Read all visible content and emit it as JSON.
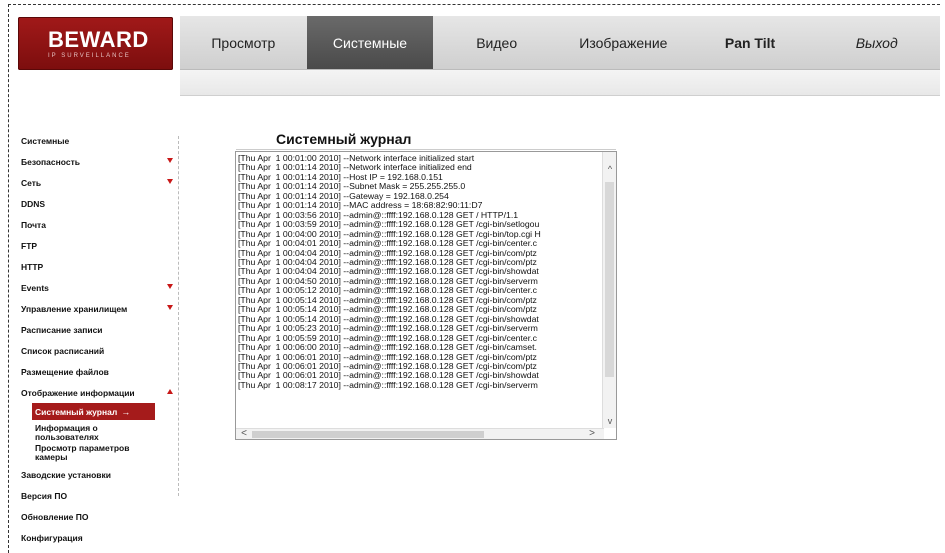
{
  "logo": {
    "brand": "BEWARD",
    "tagline": "IP SURVEILLANCE"
  },
  "nav": {
    "tabs": [
      {
        "label": "Просмотр",
        "active": false,
        "style": "normal"
      },
      {
        "label": "Системные",
        "active": true,
        "style": "normal"
      },
      {
        "label": "Видео",
        "active": false,
        "style": "normal"
      },
      {
        "label": "Изображение",
        "active": false,
        "style": "normal"
      },
      {
        "label": "Pan Tilt",
        "active": false,
        "style": "bold"
      },
      {
        "label": "Выход",
        "active": false,
        "style": "italic"
      }
    ]
  },
  "sidebar": {
    "items": [
      {
        "label": "Системные",
        "arrow": "none"
      },
      {
        "label": "Безопасность",
        "arrow": "down"
      },
      {
        "label": "Сеть",
        "arrow": "down"
      },
      {
        "label": "DDNS",
        "arrow": "none"
      },
      {
        "label": "Почта",
        "arrow": "none"
      },
      {
        "label": "FTP",
        "arrow": "none"
      },
      {
        "label": "HTTP",
        "arrow": "none"
      },
      {
        "label": "Events",
        "arrow": "down"
      },
      {
        "label": "Управление хранилищем",
        "arrow": "down"
      },
      {
        "label": "Расписание записи",
        "arrow": "none"
      },
      {
        "label": "Список расписаний",
        "arrow": "none"
      },
      {
        "label": "Размещение файлов",
        "arrow": "none"
      },
      {
        "label": "Отображение информации",
        "arrow": "up"
      }
    ],
    "subitems": {
      "active": "Системный журнал",
      "active_arrow": "→",
      "others": [
        "Информация о пользователях",
        "Просмотр параметров камеры"
      ]
    },
    "items_after": [
      {
        "label": "Заводские установки"
      },
      {
        "label": "Версия ПО"
      },
      {
        "label": "Обновление ПО"
      },
      {
        "label": "Конфигурация"
      }
    ]
  },
  "main": {
    "title": "Системный журнал",
    "log_lines": [
      "[Thu Apr  1 00:01:00 2010] --Network interface initialized start",
      "[Thu Apr  1 00:01:14 2010] --Network interface initialized end",
      "[Thu Apr  1 00:01:14 2010] --Host IP = 192.168.0.151",
      "[Thu Apr  1 00:01:14 2010] --Subnet Mask = 255.255.255.0",
      "[Thu Apr  1 00:01:14 2010] --Gateway = 192.168.0.254",
      "[Thu Apr  1 00:01:14 2010] --MAC address = 18:68:82:90:11:D7",
      "[Thu Apr  1 00:03:56 2010] --admin@::ffff:192.168.0.128 GET / HTTP/1.1",
      "[Thu Apr  1 00:03:59 2010] --admin@::ffff:192.168.0.128 GET /cgi-bin/setlogou",
      "[Thu Apr  1 00:04:00 2010] --admin@::ffff:192.168.0.128 GET /cgi-bin/top.cgi H",
      "[Thu Apr  1 00:04:01 2010] --admin@::ffff:192.168.0.128 GET /cgi-bin/center.c",
      "[Thu Apr  1 00:04:04 2010] --admin@::ffff:192.168.0.128 GET /cgi-bin/com/ptz",
      "[Thu Apr  1 00:04:04 2010] --admin@::ffff:192.168.0.128 GET /cgi-bin/com/ptz",
      "[Thu Apr  1 00:04:04 2010] --admin@::ffff:192.168.0.128 GET /cgi-bin/showdat",
      "[Thu Apr  1 00:04:50 2010] --admin@::ffff:192.168.0.128 GET /cgi-bin/serverm",
      "[Thu Apr  1 00:05:12 2010] --admin@::ffff:192.168.0.128 GET /cgi-bin/center.c",
      "[Thu Apr  1 00:05:14 2010] --admin@::ffff:192.168.0.128 GET /cgi-bin/com/ptz",
      "[Thu Apr  1 00:05:14 2010] --admin@::ffff:192.168.0.128 GET /cgi-bin/com/ptz",
      "[Thu Apr  1 00:05:14 2010] --admin@::ffff:192.168.0.128 GET /cgi-bin/showdat",
      "[Thu Apr  1 00:05:23 2010] --admin@::ffff:192.168.0.128 GET /cgi-bin/serverm",
      "[Thu Apr  1 00:05:59 2010] --admin@::ffff:192.168.0.128 GET /cgi-bin/center.c",
      "[Thu Apr  1 00:06:00 2010] --admin@::ffff:192.168.0.128 GET /cgi-bin/camset.",
      "[Thu Apr  1 00:06:01 2010] --admin@::ffff:192.168.0.128 GET /cgi-bin/com/ptz",
      "[Thu Apr  1 00:06:01 2010] --admin@::ffff:192.168.0.128 GET /cgi-bin/com/ptz",
      "[Thu Apr  1 00:06:01 2010] --admin@::ffff:192.168.0.128 GET /cgi-bin/showdat",
      "[Thu Apr  1 00:08:17 2010] --admin@::ffff:192.168.0.128 GET /cgi-bin/serverm"
    ]
  }
}
